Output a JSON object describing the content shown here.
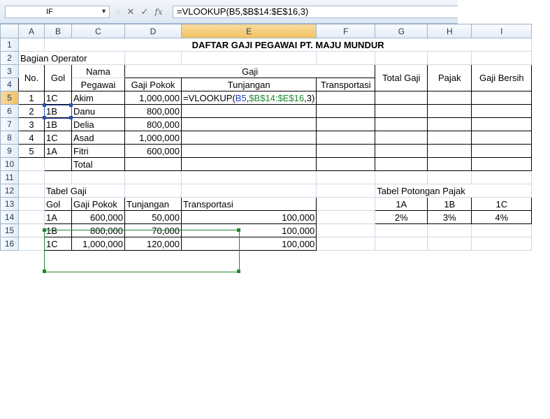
{
  "formula_bar": {
    "name_box": "IF",
    "cancel_icon": "✕",
    "enter_icon": "✓",
    "insert_function_label": "fx",
    "formula": "=VLOOKUP(B5,$B$14:$E$16,3)"
  },
  "columns": [
    "A",
    "B",
    "C",
    "D",
    "E",
    "F",
    "G",
    "H",
    "I"
  ],
  "rows": [
    "1",
    "2",
    "3",
    "4",
    "5",
    "6",
    "7",
    "8",
    "9",
    "10",
    "11",
    "12",
    "13",
    "14",
    "15",
    "16"
  ],
  "sheet": {
    "title": "DAFTAR GAJI PEGAWAI PT. MAJU MUNDUR",
    "section": "Bagian Operator",
    "headers": {
      "no": "No.",
      "gol": "Gol",
      "nama_pegawai_1": "Nama",
      "nama_pegawai_2": "Pegawai",
      "gaji": "Gaji",
      "gaji_pokok": "Gaji Pokok",
      "tunjangan": "Tunjangan",
      "transportasi": "Transportasi",
      "total_gaji": "Total Gaji",
      "pajak": "Pajak",
      "gaji_bersih": "Gaji Bersih"
    },
    "employees": [
      {
        "no": "1",
        "gol": "1C",
        "nama": "Akim",
        "gaji_pokok": "1,000,000"
      },
      {
        "no": "2",
        "gol": "1B",
        "nama": "Danu",
        "gaji_pokok": "800,000"
      },
      {
        "no": "3",
        "gol": "1B",
        "nama": "Delia",
        "gaji_pokok": "800,000"
      },
      {
        "no": "4",
        "gol": "1C",
        "nama": "Asad",
        "gaji_pokok": "1,000,000"
      },
      {
        "no": "5",
        "gol": "1A",
        "nama": "Fitri",
        "gaji_pokok": "600,000"
      }
    ],
    "edit_cell": {
      "prefix": "=VLOOKUP(",
      "ref1": "B5",
      "comma": ",",
      "ref2": "$B$14:$E$16",
      "suffix": ",3)"
    },
    "total_label": "Total",
    "tabel_gaji": {
      "title": "Tabel Gaji",
      "headers": [
        "Gol",
        "Gaji Pokok",
        "Tunjangan",
        "Transportasi"
      ],
      "rows": [
        [
          "1A",
          "600,000",
          "50,000",
          "100,000"
        ],
        [
          "1B",
          "800,000",
          "70,000",
          "100,000"
        ],
        [
          "1C",
          "1,000,000",
          "120,000",
          "100,000"
        ]
      ]
    },
    "tabel_pajak": {
      "title": "Tabel Potongan Pajak",
      "headers": [
        "1A",
        "1B",
        "1C"
      ],
      "values": [
        "2%",
        "3%",
        "4%"
      ]
    }
  },
  "colors": {
    "ref1": "#1f3fbf",
    "ref2": "#1e8a2f",
    "selected_header": "#f1c15f"
  }
}
